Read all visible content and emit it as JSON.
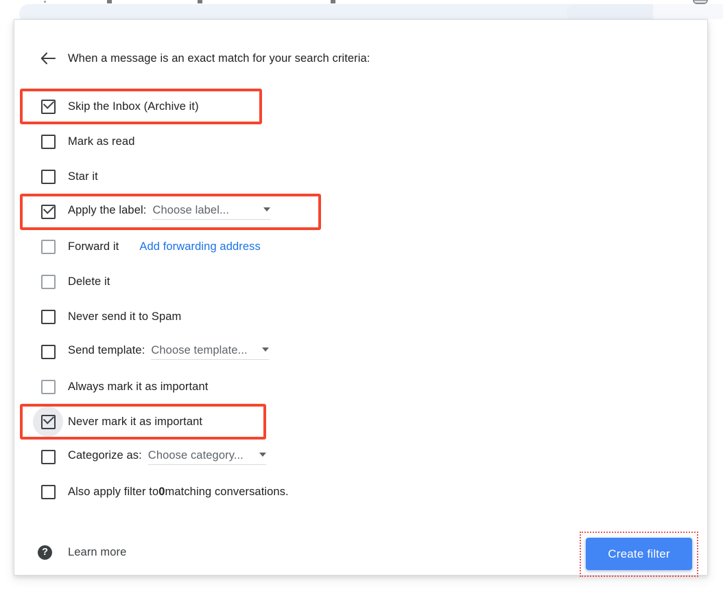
{
  "window": {
    "top_bar_present": true
  },
  "card": {
    "header": {
      "back_icon": "back-arrow-icon",
      "title": "When a message is an exact match for your search criteria:"
    },
    "options": [
      {
        "id": "skip-inbox",
        "label": "Skip the Inbox (Archive it)",
        "checked": true,
        "checkbox_style": "dark",
        "highlighted": true
      },
      {
        "id": "mark-as-read",
        "label": "Mark as read",
        "checked": false,
        "checkbox_style": "dark",
        "highlighted": false
      },
      {
        "id": "star-it",
        "label": "Star it",
        "checked": false,
        "checkbox_style": "dark",
        "highlighted": false
      },
      {
        "id": "apply-label",
        "label": "Apply the label:",
        "checked": true,
        "checkbox_style": "dark",
        "highlighted": true,
        "select": {
          "value": "Choose label...",
          "caret": "chevron-down-icon"
        }
      },
      {
        "id": "forward-it",
        "label": "Forward it",
        "checked": false,
        "checkbox_style": "light",
        "highlighted": false,
        "link": "Add forwarding address"
      },
      {
        "id": "delete-it",
        "label": "Delete it",
        "checked": false,
        "checkbox_style": "light",
        "highlighted": false
      },
      {
        "id": "never-send-to-spam",
        "label": "Never send it to Spam",
        "checked": false,
        "checkbox_style": "dark",
        "highlighted": false
      },
      {
        "id": "send-template",
        "label": "Send template:",
        "checked": false,
        "checkbox_style": "dark",
        "highlighted": false,
        "select": {
          "value": "Choose template...",
          "caret": "chevron-down-icon"
        }
      },
      {
        "id": "always-mark-important",
        "label": "Always mark it as important",
        "checked": false,
        "checkbox_style": "light",
        "highlighted": false
      },
      {
        "id": "never-mark-important",
        "label": "Never mark it as important",
        "checked": true,
        "checkbox_style": "dark",
        "highlighted": true,
        "ripple": true
      },
      {
        "id": "categorize-as",
        "label": "Categorize as:",
        "checked": false,
        "checkbox_style": "dark",
        "highlighted": false,
        "select": {
          "value": "Choose category...",
          "caret": "chevron-down-icon"
        }
      },
      {
        "id": "also-apply-filter",
        "label_before": "Also apply filter to ",
        "count": "0",
        "label_after": " matching conversations.",
        "checked": false,
        "checkbox_style": "dark",
        "highlighted": false
      }
    ],
    "footer": {
      "help_icon": "help-circle-icon",
      "learn_more_label": "Learn more",
      "create_filter_label": "Create filter"
    }
  },
  "annotation": {
    "highlight_color": "#f4462e",
    "button_outline_color": "#ef5350",
    "button_color": "#4285f4",
    "link_color": "#1a73e8"
  }
}
